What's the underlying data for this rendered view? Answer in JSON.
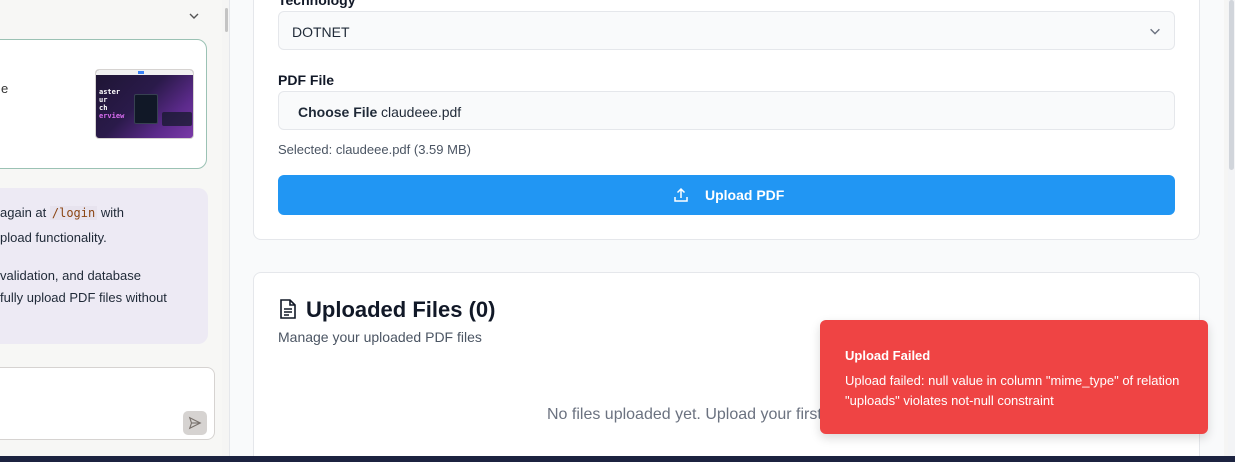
{
  "chat": {
    "artifact_fragment": "e",
    "thumbnail_lines": [
      "aster",
      "ur",
      "ch",
      "erview"
    ],
    "message_lines": [
      {
        "pre": "again at ",
        "code": "/login",
        "post": " with"
      },
      {
        "text": "pload functionality."
      },
      {
        "text": "validation, and database"
      },
      {
        "text": "fully upload PDF files without"
      }
    ]
  },
  "form": {
    "technology_label": "Technology",
    "technology_value": "DOTNET",
    "pdf_label": "PDF File",
    "choose_file_label": "Choose File",
    "file_name": "claudeee.pdf",
    "selected_text": "Selected: claudeee.pdf (3.59 MB)",
    "upload_button_label": "Upload PDF"
  },
  "files": {
    "title": "Uploaded Files (0)",
    "subtitle": "Manage your uploaded PDF files",
    "empty_text": "No files uploaded yet. Upload your first"
  },
  "toast": {
    "title": "Upload Failed",
    "description": "Upload failed: null value in column \"mime_type\" of relation \"uploads\" violates not-null constraint",
    "color": "#ef4444"
  },
  "colors": {
    "primary": "#2196f3",
    "error": "#ef4444"
  }
}
